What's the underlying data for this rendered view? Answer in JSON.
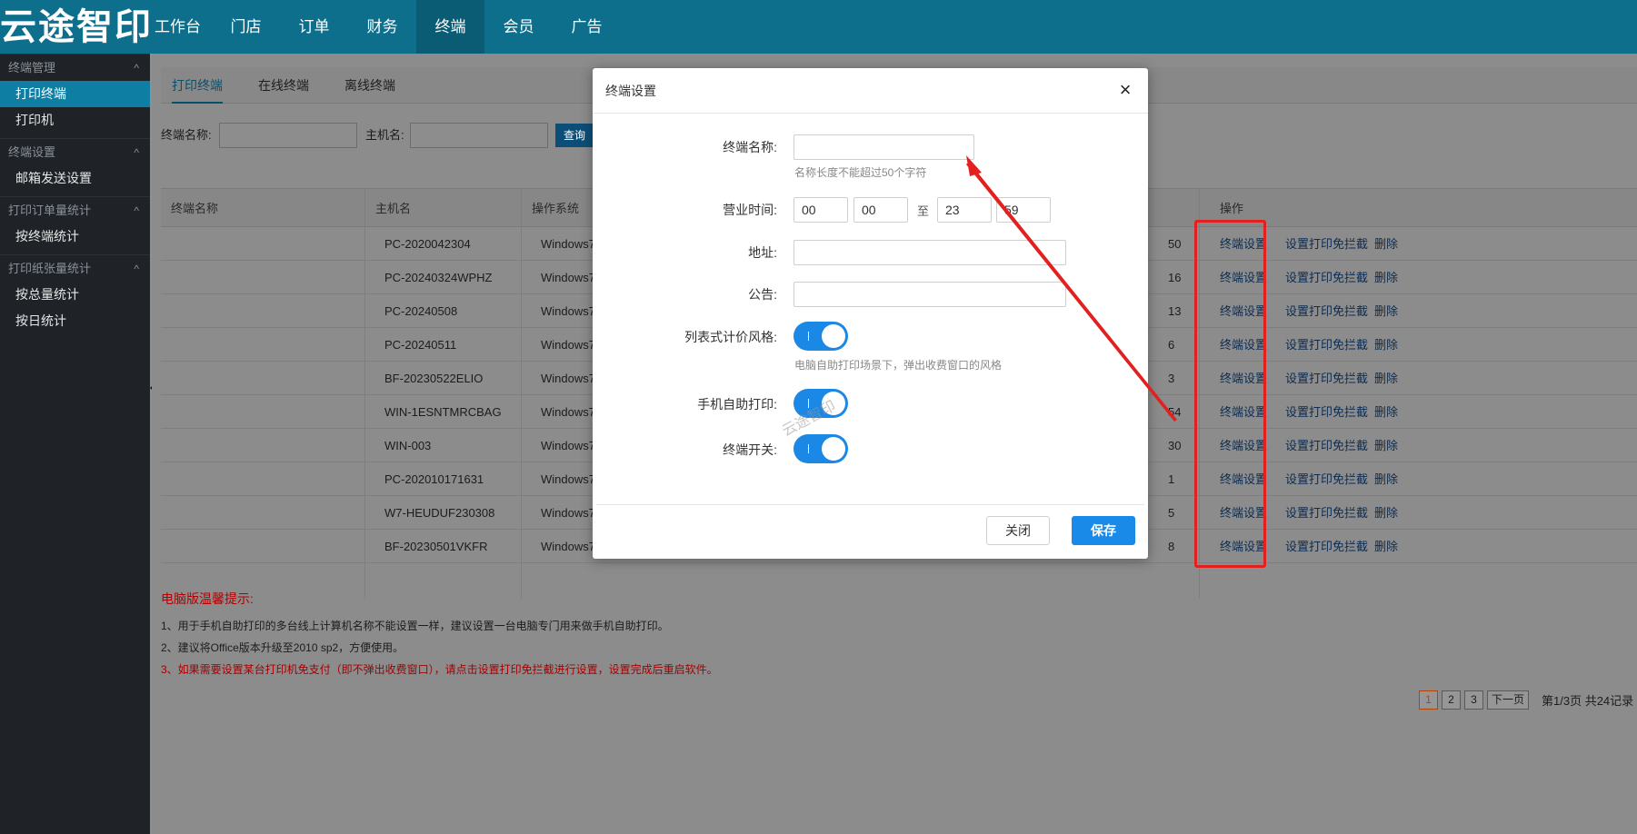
{
  "header": {
    "logo": "云途智印",
    "nav": [
      "工作台",
      "门店",
      "订单",
      "财务",
      "终端",
      "会员",
      "广告"
    ],
    "active_nav": "终端"
  },
  "sidebar": {
    "groups": [
      {
        "title": "终端管理",
        "items": [
          "打印终端",
          "打印机"
        ]
      },
      {
        "title": "终端设置",
        "items": [
          "邮箱发送设置"
        ]
      },
      {
        "title": "打印订单量统计",
        "items": [
          "按终端统计"
        ]
      },
      {
        "title": "打印纸张量统计",
        "items": [
          "按总量统计",
          "按日统计"
        ]
      }
    ],
    "active_item": "打印终端"
  },
  "tabs": [
    "打印终端",
    "在线终端",
    "离线终端"
  ],
  "filter": {
    "name_label": "终端名称:",
    "host_label": "主机名:",
    "query_label": "查询"
  },
  "table": {
    "headers": [
      "终端名称",
      "主机名",
      "操作系统",
      "操作"
    ],
    "rows": [
      {
        "host": "PC-2020042304",
        "os": "Windows7",
        "tail": "50"
      },
      {
        "host": "PC-20240324WPHZ",
        "os": "Windows7",
        "tail": "16"
      },
      {
        "host": "PC-20240508",
        "os": "Windows7",
        "tail": "13"
      },
      {
        "host": "PC-20240511",
        "os": "Windows7",
        "tail": "6"
      },
      {
        "host": "BF-20230522ELIO",
        "os": "Windows7",
        "tail": "3"
      },
      {
        "host": "WIN-1ESNTMRCBAG",
        "os": "Windows7",
        "tail": "54"
      },
      {
        "host": "WIN-003",
        "os": "Windows7",
        "tail": "30"
      },
      {
        "host": "PC-202010171631",
        "os": "Windows7",
        "tail": "1"
      },
      {
        "host": "W7-HEUDUF230308",
        "os": "Windows7",
        "tail": "5"
      },
      {
        "host": "BF-20230501VKFR",
        "os": "Windows7",
        "tail": "8"
      }
    ],
    "ops": [
      "终端设置",
      "设置打印免拦截",
      "删除"
    ]
  },
  "tips": {
    "title": "电脑版温馨提示:",
    "items": [
      "1、用于手机自助打印的多台线上计算机名称不能设置一样，建议设置一台电脑专门用来做手机自助打印。",
      "2、建议将Office版本升级至2010 sp2，方便使用。",
      "3、如果需要设置某台打印机免支付（即不弹出收费窗口），请点击设置打印免拦截进行设置，设置完成后重启软件。"
    ]
  },
  "pager": {
    "pages": [
      "1",
      "2",
      "3"
    ],
    "next": "下一页",
    "info": "第1/3页 共24记录"
  },
  "modal": {
    "title": "终端设置",
    "close_icon": "×",
    "fields": {
      "name_label": "终端名称:",
      "name_value": "",
      "name_hint": "名称长度不能超过50个字符",
      "hours_label": "营业时间:",
      "hours": {
        "start_h": "00",
        "start_m": "00",
        "sep": "至",
        "end_h": "23",
        "end_m": "59"
      },
      "address_label": "地址:",
      "address_value": "",
      "notice_label": "公告:",
      "notice_value": "",
      "list_price_label": "列表式计价风格:",
      "list_price_on": true,
      "list_price_hint": "电脑自助打印场景下，弹出收费窗口的风格",
      "mobile_print_label": "手机自助打印:",
      "mobile_print_on": true,
      "terminal_switch_label": "终端开关:",
      "terminal_switch_on": true
    },
    "watermark": "云途智印",
    "close_button": "关闭",
    "save_button": "保存"
  },
  "colors": {
    "header": "#0e6f8c",
    "sidebar": "#1f2328",
    "primary": "#1a8ae8",
    "annotation": "#e22020"
  }
}
